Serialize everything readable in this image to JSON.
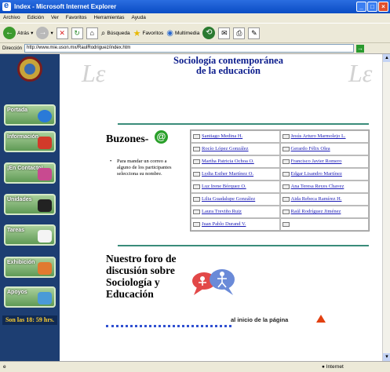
{
  "window": {
    "title": "Index - Microsoft Internet Explorer"
  },
  "menu": [
    "Archivo",
    "Edición",
    "Ver",
    "Favoritos",
    "Herramientas",
    "Ayuda"
  ],
  "toolbar": {
    "back": "Atrás",
    "search": "Búsqueda",
    "favorites": "Favoritos",
    "multimedia": "Multimedia"
  },
  "address": {
    "label": "Dirección",
    "url": "http://www.mie.uson.mx/RaulRodriguez/index.htm"
  },
  "page": {
    "title_line1": "Sociología contemporánea",
    "title_line2": "de la educación",
    "lc_mark": "Lε"
  },
  "nav": [
    {
      "label": "Portada",
      "icon": "ie-logo-icon"
    },
    {
      "label": "Información",
      "icon": "info-icon"
    },
    {
      "label": "¡En Contacto!",
      "icon": "people-icon"
    },
    {
      "label": "Unidades",
      "icon": "folder-icon"
    },
    {
      "label": "Tareas",
      "icon": "book-icon"
    },
    {
      "label": "Exhibición",
      "icon": "exhibit-icon"
    },
    {
      "label": "Apoyos",
      "icon": "support-icon"
    }
  ],
  "clock": "Son las 18: 59 hrs.",
  "buzones": {
    "heading": "Buzones-",
    "note": "Para mandar un correo a alguno de los participantes selecciona su nombre.",
    "names": [
      [
        "Santiago Medina H.",
        "Jesús Arturo Marmolejo L."
      ],
      [
        "Rocío López González",
        "Gerardo Félix Olea"
      ],
      [
        "Martha Patricia Ochoa O.",
        "Francisco Javier Romero"
      ],
      [
        "Lydia Esther Martínez O.",
        "Edgar Lisandro Martínez"
      ],
      [
        "Luz Irene Bórquez O.",
        "Ana Teresa Reyes Chavez"
      ],
      [
        "Lilia Guadalupe González",
        "Aida Rebeca Ramírez H."
      ],
      [
        "Laura Treviño Ruiz",
        "Raúl Rodríguez Jiménez"
      ],
      [
        "Juan Pablo Durand V.",
        ""
      ]
    ]
  },
  "forum": {
    "text": "Nuestro foro de discusión sobre Sociología y Educación"
  },
  "footer": {
    "top_link": "al inicio de la página"
  },
  "status": {
    "zone": "Internet"
  }
}
